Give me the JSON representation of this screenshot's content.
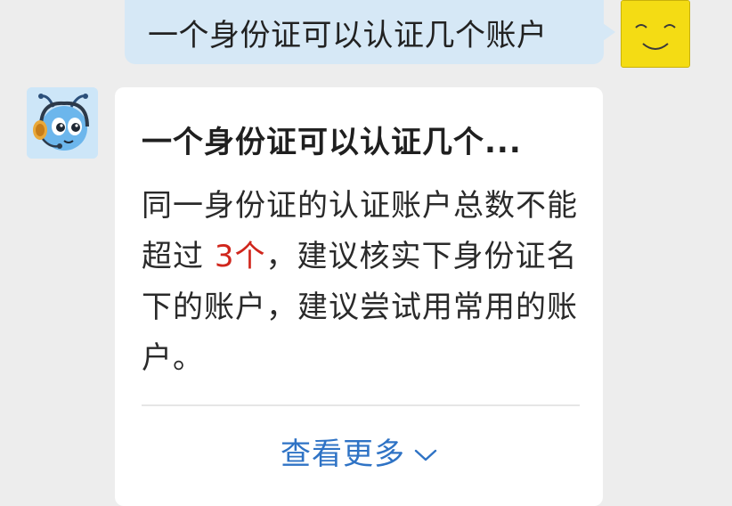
{
  "user_message": {
    "text": "一个身份证可以认证几个账户"
  },
  "bot_message": {
    "title": "一个身份证可以认证几个...",
    "body_before": "同一身份证的认证账户总数不能超过 ",
    "body_highlight": "3个",
    "body_after": "，建议核实下身份证名下的账户，建议尝试用常用的账户。",
    "more_label": "查看更多"
  },
  "colors": {
    "background": "#ededed",
    "user_bubble": "#d6e8f6",
    "highlight": "#d0261c",
    "link": "#2f73c5"
  },
  "icons": {
    "user_avatar": "smiley-face-icon",
    "bot_avatar": "ant-assistant-icon",
    "more_chevron": "chevron-down-icon"
  }
}
